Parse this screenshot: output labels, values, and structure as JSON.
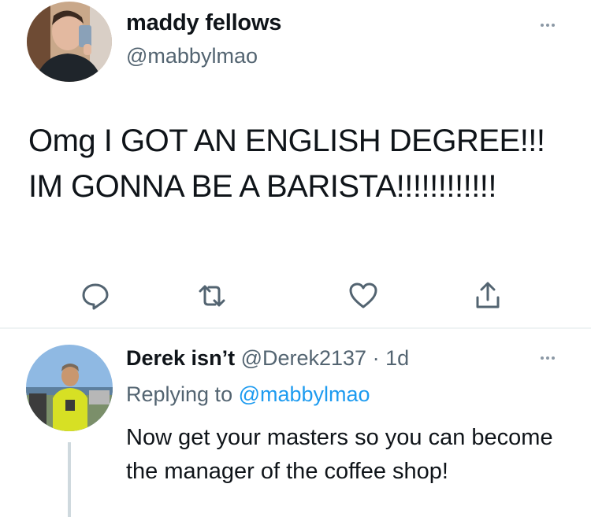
{
  "main_tweet": {
    "display_name": "maddy fellows",
    "handle": "@mabbylmao",
    "text": "Omg I GOT AN ENGLISH DEGREE!!! IM GONNA BE A BARISTA!!!!!!!!!!!!",
    "actions": [
      "reply-icon",
      "retweet-icon",
      "like-icon",
      "share-icon"
    ]
  },
  "reply_tweet": {
    "display_name": "Derek isn’t",
    "handle": "@Derek2137",
    "separator": "·",
    "time": "1d",
    "replying_prefix": "Replying to ",
    "replying_handle": "@mabbylmao",
    "text": "Now get your masters so you can become the manager of the coffee shop!"
  },
  "colors": {
    "text_primary": "#0f1419",
    "text_secondary": "#536471",
    "link_blue": "#1d9bf0",
    "icon_gray": "#536471",
    "divider": "#eff3f4"
  }
}
